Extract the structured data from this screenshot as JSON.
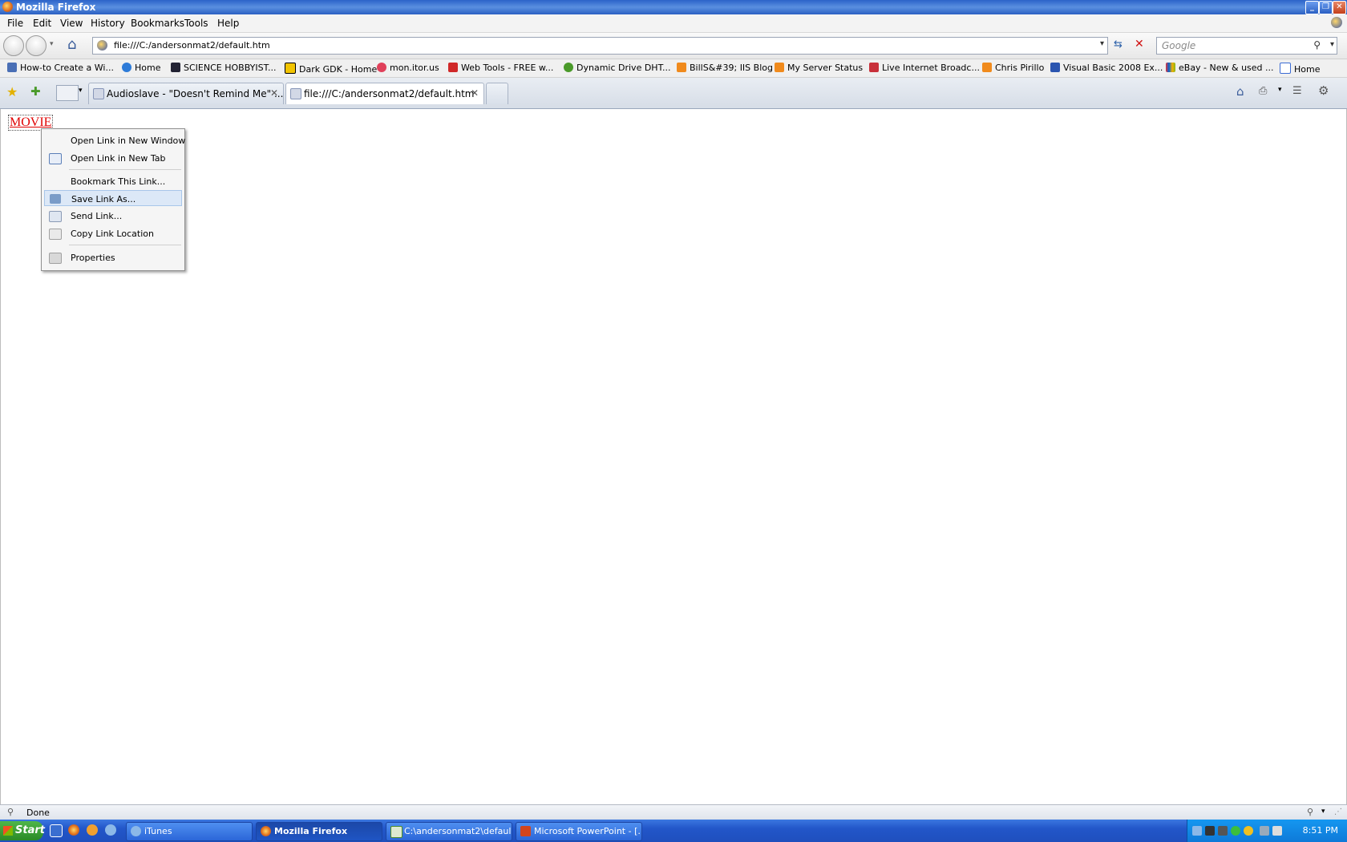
{
  "window": {
    "title": "Mozilla Firefox"
  },
  "menubar": {
    "items": [
      "File",
      "Edit",
      "View",
      "History",
      "Bookmarks",
      "Tools",
      "Help"
    ]
  },
  "navbar": {
    "url": "file:///C:/andersonmat2/default.htm",
    "search_placeholder": "Google"
  },
  "bookmarks": [
    {
      "label": "How-to Create a Wi...",
      "icon": "blue-icon"
    },
    {
      "label": "Home",
      "icon": "globe-icon"
    },
    {
      "label": "SCIENCE HOBBYIST...",
      "icon": "science-icon"
    },
    {
      "label": "Dark GDK - Home",
      "icon": "gdk-icon"
    },
    {
      "label": "mon.itor.us",
      "icon": "monitor-icon"
    },
    {
      "label": "Web Tools - FREE w...",
      "icon": "shield-icon"
    },
    {
      "label": "Dynamic Drive DHT...",
      "icon": "dd-icon"
    },
    {
      "label": "BillS&#39; IIS Blog",
      "icon": "rss-icon"
    },
    {
      "label": "My Server Status",
      "icon": "rss-icon"
    },
    {
      "label": "Live Internet Broadc...",
      "icon": "broadcast-icon"
    },
    {
      "label": "Chris Pirillo",
      "icon": "rss-icon"
    },
    {
      "label": "Visual Basic 2008 Ex...",
      "icon": "vb-icon"
    },
    {
      "label": "eBay - New & used ...",
      "icon": "ebay-icon"
    },
    {
      "label": "Home",
      "icon": "google-icon"
    }
  ],
  "tabs": [
    {
      "label": "Audioslave - \"Doesn't Remind Me\" ...",
      "active": false
    },
    {
      "label": "file:///C:/andersonmat2/default.htm",
      "active": true
    }
  ],
  "content": {
    "link_text": "MOVIE"
  },
  "context_menu": {
    "items": [
      {
        "label": "Open Link in New Window"
      },
      {
        "label": "Open Link in New Tab"
      },
      {
        "label": "Bookmark This Link..."
      },
      {
        "label": "Save Link As..."
      },
      {
        "label": "Send Link..."
      },
      {
        "label": "Copy Link Location"
      },
      {
        "label": "Properties"
      }
    ],
    "highlighted": "Save Link As..."
  },
  "status": {
    "text": "Done"
  },
  "taskbar": {
    "start_label": "Start",
    "buttons": [
      {
        "label": "iTunes",
        "active": false
      },
      {
        "label": "Mozilla Firefox",
        "active": true
      },
      {
        "label": "C:\\andersonmat2\\defaul...",
        "active": false
      },
      {
        "label": "Microsoft PowerPoint - [...",
        "active": false
      }
    ],
    "clock": "8:51 PM"
  },
  "colors": {
    "link": "#e00000",
    "highlight": "#dce8f7",
    "taskbar": "#2256c9"
  }
}
